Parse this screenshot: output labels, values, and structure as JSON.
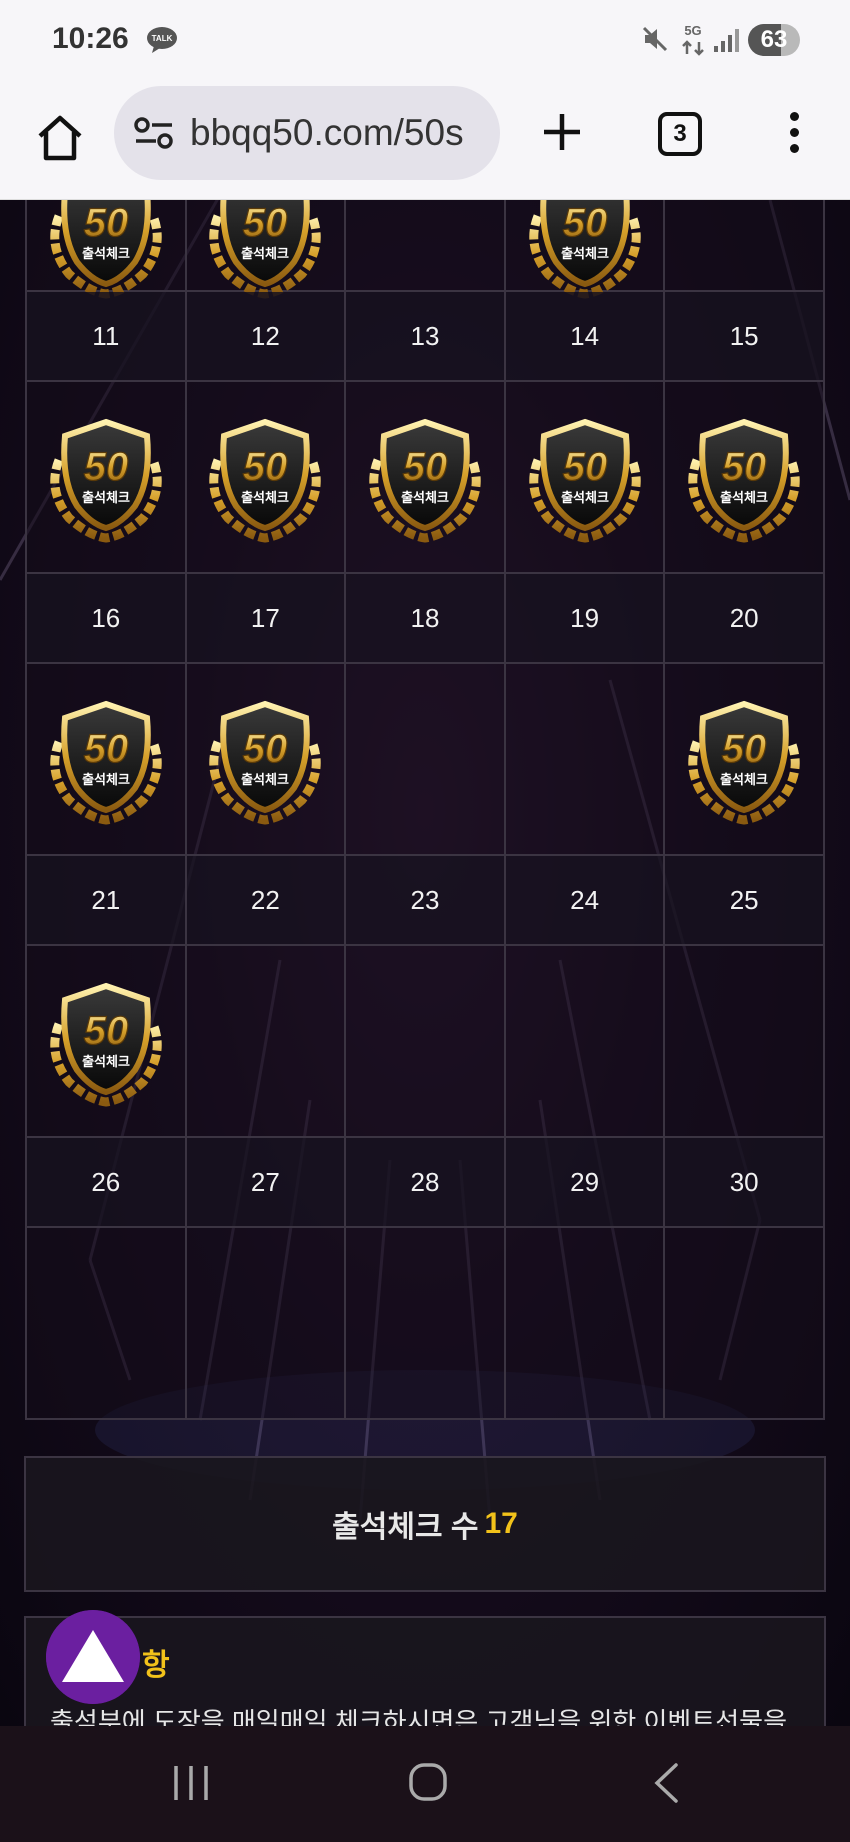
{
  "status_bar": {
    "time": "10:26",
    "talk_badge": "TALK",
    "network": "5G",
    "battery": "63"
  },
  "browser": {
    "url": "bbqq50.com/50s",
    "tab_count": "3"
  },
  "calendar": {
    "badge_text": "50",
    "badge_caption": "출석체크",
    "partial_top_row_stamps": [
      true,
      true,
      false,
      true,
      false
    ],
    "weeks": [
      {
        "days": [
          "11",
          "12",
          "13",
          "14",
          "15"
        ],
        "stamps": [
          true,
          true,
          true,
          true,
          true
        ]
      },
      {
        "days": [
          "16",
          "17",
          "18",
          "19",
          "20"
        ],
        "stamps": [
          true,
          true,
          false,
          false,
          true
        ]
      },
      {
        "days": [
          "21",
          "22",
          "23",
          "24",
          "25"
        ],
        "stamps": [
          true,
          false,
          false,
          false,
          false
        ]
      },
      {
        "days": [
          "26",
          "27",
          "28",
          "29",
          "30"
        ],
        "stamps": [
          false,
          false,
          false,
          false,
          false
        ]
      }
    ]
  },
  "summary": {
    "label": "출석체크 수",
    "count": "17"
  },
  "notice": {
    "title_visible": "항",
    "text": "출석부에 도장을 매일매일 체크하시면은 고객님을 위한 이벤트선물을"
  },
  "colors": {
    "accent_gold": "#f2c21a",
    "fab_purple": "#6b1fa0",
    "grid_line": "#3b3442"
  },
  "icons": {
    "talk": "talk-icon",
    "mute": "mute-icon",
    "home": "home-icon",
    "site_settings": "site-settings-icon",
    "new_tab": "plus-icon",
    "menu": "more-vert-icon",
    "fab": "triangle-up-icon",
    "nav_recent": "recent-apps-icon",
    "nav_home": "home-circle-icon",
    "nav_back": "back-chevron-icon"
  }
}
